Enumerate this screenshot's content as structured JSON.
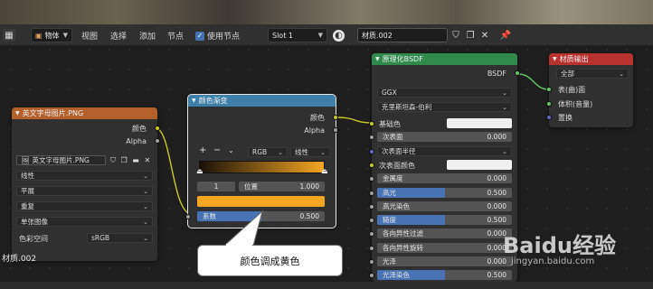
{
  "header": {
    "object_mode": "物体",
    "menus": [
      "视图",
      "选择",
      "添加",
      "节点"
    ],
    "use_nodes_label": "使用节点",
    "slot": "Slot 1",
    "material_name": "材质.002"
  },
  "image_node": {
    "title": "英文字母图片.PNG",
    "outputs": [
      "颜色",
      "Alpha"
    ],
    "image_name": "英文字母图片.PNG",
    "interpolation": "线性",
    "projection": "平展",
    "extension": "重复",
    "source": "单张图像",
    "colorspace_label": "色彩空间",
    "colorspace_value": "sRGB"
  },
  "color_ramp_node": {
    "title": "颜色渐变",
    "outputs": [
      "颜色",
      "Alpha"
    ],
    "add_label": "+",
    "remove_label": "−",
    "color_mode": "RGB",
    "interpolation": "线性",
    "stop_index": "1",
    "position_label": "位置",
    "position_value": "1.000",
    "input_label": "系数",
    "input_value": "0.500",
    "selected_color": "#f5a623",
    "ramp_start_color": "#1a1108",
    "ramp_end_color": "#f5a623"
  },
  "bsdf_node": {
    "title": "原理化BSDF",
    "output": "BSDF",
    "distribution": "GGX",
    "subsurface_method": "克里斯坦森-伯利",
    "inputs": [
      {
        "label": "基础色",
        "type": "color",
        "color": "#f0f0f0"
      },
      {
        "label": "次表面",
        "value": "0.000"
      },
      {
        "label": "次表面半径",
        "type": "dropdown"
      },
      {
        "label": "次表面颜色",
        "type": "color",
        "color": "#f0f0f0"
      },
      {
        "label": "金属度",
        "value": "0.000"
      },
      {
        "label": "高光",
        "value": "0.500",
        "fill": 0.5
      },
      {
        "label": "高光染色",
        "value": "0.000"
      },
      {
        "label": "糙度",
        "value": "0.500",
        "fill": 0.5
      },
      {
        "label": "各向异性过滤",
        "value": "0.000"
      },
      {
        "label": "各向异性旋转",
        "value": "0.000"
      },
      {
        "label": "光泽",
        "value": "0.000"
      },
      {
        "label": "光泽染色",
        "value": "0.500",
        "fill": 0.5
      }
    ]
  },
  "output_node": {
    "title": "材质输出",
    "target": "全部",
    "inputs": [
      "表(曲)面",
      "体积(音量)",
      "置换"
    ]
  },
  "material_label": "材质.002",
  "callout_text": "颜色调成黄色",
  "watermark": {
    "brand": "Baidu经验",
    "url": "jingyan.baidu.com"
  },
  "colors": {
    "image_header": "#b4602a",
    "ramp_header": "#3d7fa8",
    "bsdf_header": "#2f8a4c",
    "output_header": "#b8322f",
    "socket_yellow": "#c7c729",
    "socket_grey": "#a1a1a1",
    "socket_blue": "#6363c7",
    "socket_green": "#63c763"
  }
}
